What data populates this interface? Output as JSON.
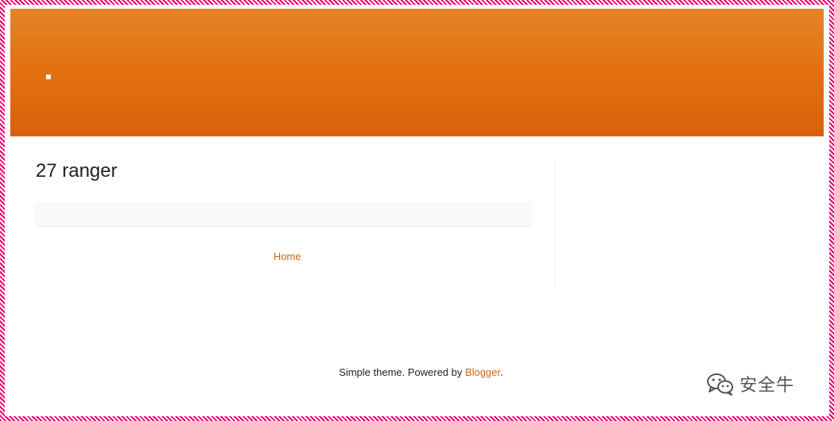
{
  "blog": {
    "post_title": "27 ranger",
    "home_link": "Home"
  },
  "footer": {
    "prefix": "Simple theme. Powered by ",
    "link": "Blogger",
    "suffix": "."
  },
  "watermark": {
    "icon": "wechat-icon",
    "text": "安全牛"
  },
  "colors": {
    "header_top": "#e5832a",
    "header_bottom": "#d9600a",
    "link": "#cc6611",
    "frame": "#e6006e"
  }
}
